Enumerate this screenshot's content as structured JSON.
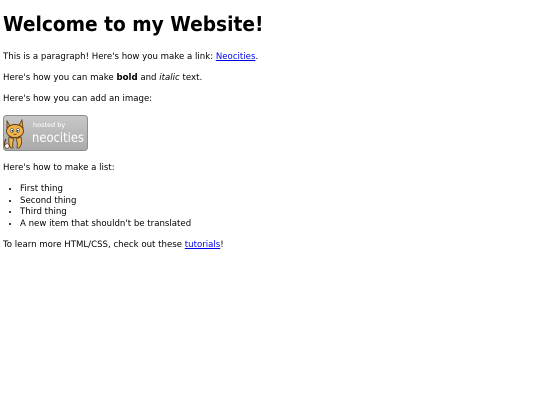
{
  "heading": "Welcome to my Website!",
  "para_link": {
    "before": "This is a paragraph! Here's how you make a link: ",
    "link_text": "Neocities",
    "after": "."
  },
  "para_format": {
    "before": "Here's how you can make ",
    "bold": "bold",
    "middle": " and ",
    "italic": "italic",
    "after": " text."
  },
  "para_image": "Here's how you can add an image:",
  "badge": {
    "small_text": "hosted by",
    "big_text": "neocities",
    "background_color": "#b7b7b7",
    "icon": "neocities-cat-logo"
  },
  "para_list": "Here's how to make a list:",
  "list_items": [
    "First thing",
    "Second thing",
    "Third thing",
    "A new item that shouldn't be translated"
  ],
  "para_tutorials": {
    "before": "To learn more HTML/CSS, check out these ",
    "link_text": "tutorials",
    "after": "!"
  },
  "colors": {
    "link": "#0000ee",
    "text": "#000000",
    "background": "#ffffff"
  }
}
